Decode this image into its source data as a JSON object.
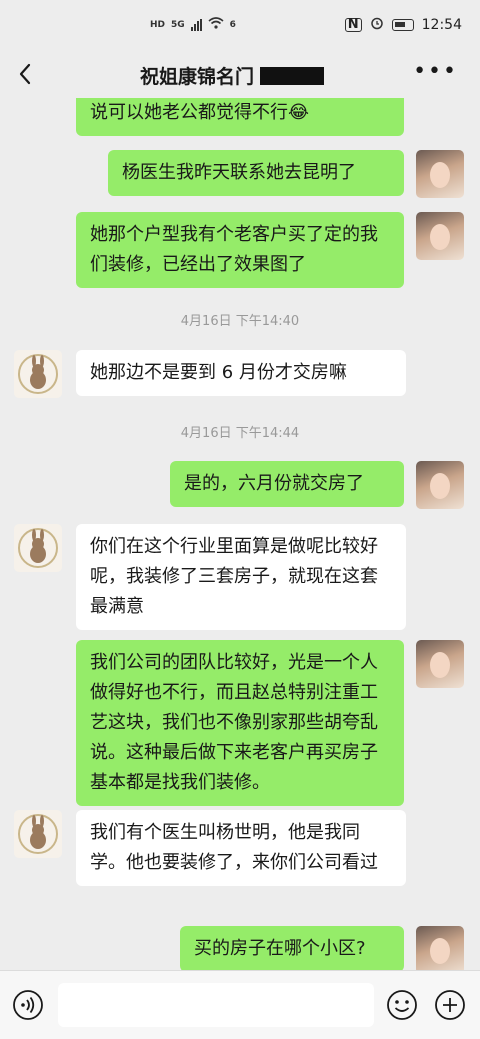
{
  "status_bar": {
    "hd": "HD",
    "network": "5G",
    "wifi_badge": "6",
    "time": "12:54"
  },
  "header": {
    "title": "祝姐康锦名门"
  },
  "messages": {
    "m0": "说可以她老公都觉得不行😂",
    "m1": "杨医生我昨天联系她去昆明了",
    "m2": "她那个户型我有个老客户买了定的我们装修，已经出了效果图了",
    "t1": "4月16日 下午14:40",
    "m3": "她那边不是要到 6 月份才交房嘛",
    "t2": "4月16日 下午14:44",
    "m4": "是的，六月份就交房了",
    "m5": "你们在这个行业里面算是做呢比较好呢，我装修了三套房子，就现在这套最满意",
    "m6": "我们公司的团队比较好，光是一个人做得好也不行，而且赵总特别注重工艺这块，我们也不像别家那些胡夸乱说。这种最后做下来老客户再买房子基本都是找我们装修。",
    "m7": "我们有个医生叫杨世明，他是我同学。他也要装修了，来你们公司看过",
    "m8": "买的房子在哪个小区?"
  },
  "colors": {
    "mine_bubble": "#95ec69",
    "their_bubble": "#ffffff",
    "background": "#ededed"
  },
  "icons": {
    "back": "chevron-left-icon",
    "more": "more-dots-icon",
    "voice": "voice-icon",
    "emoji": "emoji-icon",
    "plus": "plus-icon"
  }
}
